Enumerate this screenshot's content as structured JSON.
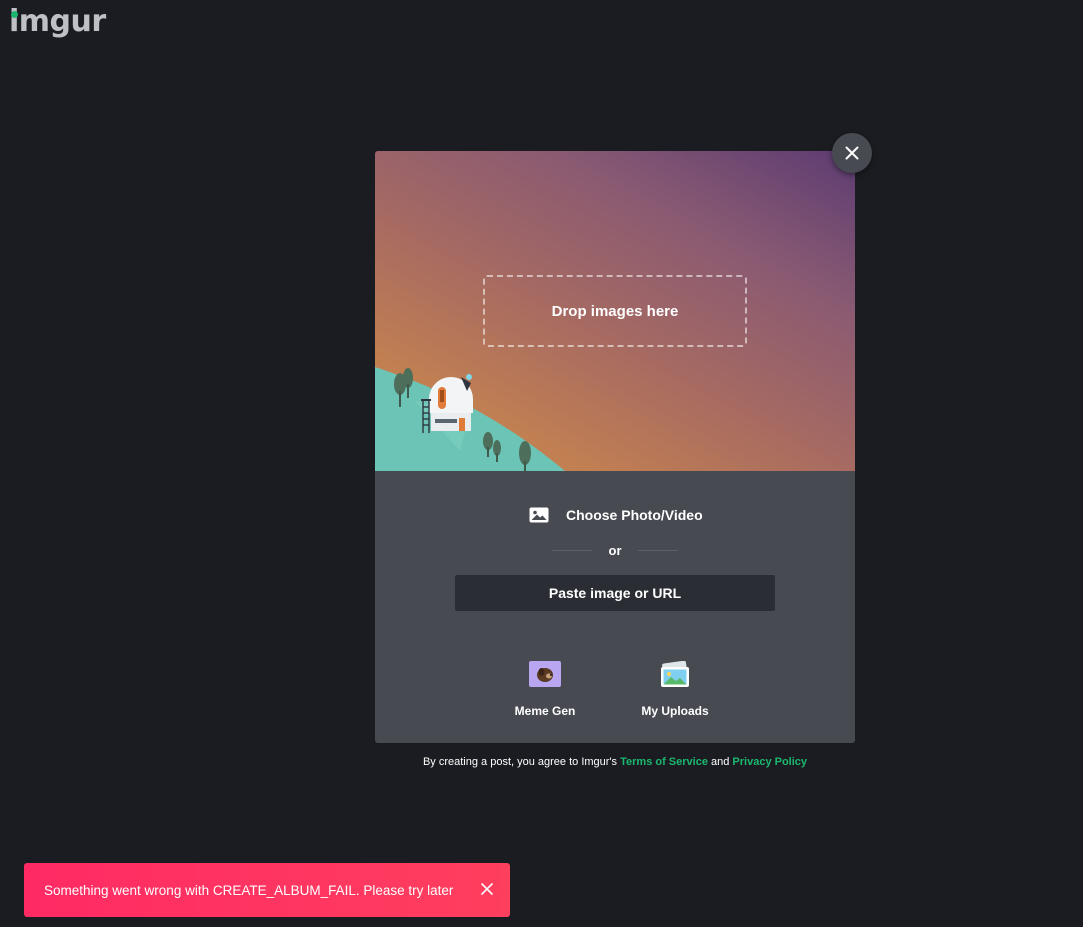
{
  "brand": {
    "name": "imgur",
    "accent": "#1bb76e"
  },
  "modal": {
    "drop_zone_label": "Drop images here",
    "choose_label": "Choose Photo/Video",
    "choose_icon": "image-icon",
    "or_label": "or",
    "paste_label": "Paste image or URL",
    "tools": [
      {
        "label": "Meme Gen",
        "icon": "meme-dog-icon"
      },
      {
        "label": "My Uploads",
        "icon": "photos-stack-icon"
      }
    ],
    "close_icon": "close-icon"
  },
  "terms": {
    "prefix": "By creating a post, you agree to Imgur's ",
    "tos_label": "Terms of Service",
    "joiner": " and ",
    "privacy_label": "Privacy Policy"
  },
  "toast": {
    "message": "Something went wrong with CREATE_ALBUM_FAIL. Please try later",
    "color": "#ff2e63",
    "close_icon": "close-icon"
  }
}
